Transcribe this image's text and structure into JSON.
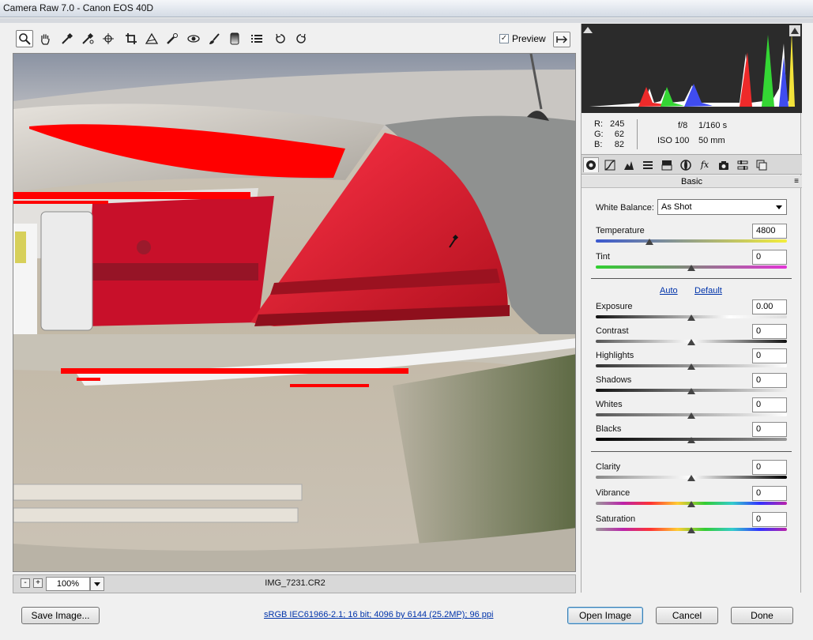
{
  "window": {
    "title": "Camera Raw 7.0  -  Canon EOS 40D"
  },
  "toolbar": {
    "tools": [
      "zoom-icon",
      "hand-icon",
      "white-balance-icon",
      "color-sampler-icon",
      "targeted-adjust-icon",
      "crop-icon",
      "straighten-icon",
      "spot-removal-icon",
      "red-eye-icon",
      "adjustment-brush-icon",
      "graduated-filter-icon",
      "presets-list-icon",
      "rotate-ccw-icon",
      "rotate-cw-icon"
    ],
    "preview_label": "Preview",
    "preview_checked": true
  },
  "readout": {
    "r_label": "R:",
    "r": "245",
    "g_label": "G:",
    "g": "62",
    "b_label": "B:",
    "b": "82",
    "aperture": "f/8",
    "shutter": "1/160 s",
    "iso": "ISO 100",
    "focal": "50 mm"
  },
  "panel": {
    "title": "Basic",
    "wb_label": "White Balance:",
    "wb_value": "As Shot",
    "auto": "Auto",
    "default": "Default",
    "sliders": [
      {
        "label": "Temperature",
        "value": "4800",
        "pos": 0.28
      },
      {
        "label": "Tint",
        "value": "0",
        "pos": 0.5
      },
      {
        "label": "Exposure",
        "value": "0.00",
        "pos": 0.5
      },
      {
        "label": "Contrast",
        "value": "0",
        "pos": 0.5
      },
      {
        "label": "Highlights",
        "value": "0",
        "pos": 0.5
      },
      {
        "label": "Shadows",
        "value": "0",
        "pos": 0.5
      },
      {
        "label": "Whites",
        "value": "0",
        "pos": 0.5
      },
      {
        "label": "Blacks",
        "value": "0",
        "pos": 0.5
      },
      {
        "label": "Clarity",
        "value": "0",
        "pos": 0.5
      },
      {
        "label": "Vibrance",
        "value": "0",
        "pos": 0.5
      },
      {
        "label": "Saturation",
        "value": "0",
        "pos": 0.5
      }
    ]
  },
  "bottom": {
    "zoom_minus": "-",
    "zoom_plus": "+",
    "zoom": "100%",
    "filename": "IMG_7231.CR2"
  },
  "footer": {
    "save": "Save Image...",
    "info": "sRGB IEC61966-2.1; 16 bit; 4096 by 6144 (25.2MP); 96 ppi",
    "open": "Open Image",
    "cancel": "Cancel",
    "done": "Done"
  },
  "colors": {
    "clip_warning": "#ff0000",
    "link": "#0033aa"
  }
}
